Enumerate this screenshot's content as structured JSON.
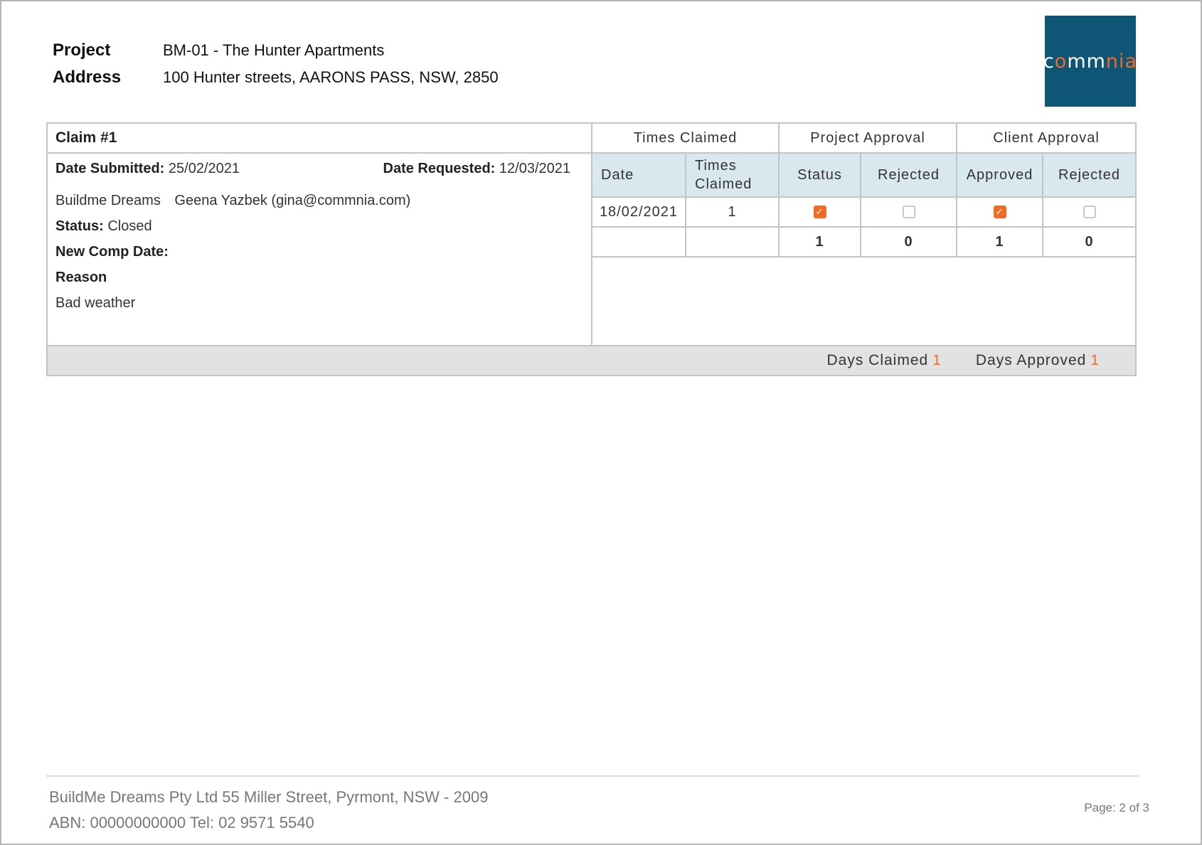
{
  "header": {
    "project_label": "Project",
    "project_value": "BM-01 -  The Hunter Apartments",
    "address_label": "Address",
    "address_value": "100 Hunter streets, AARONS PASS, NSW, 2850",
    "logo": {
      "part1": "c",
      "part2": "o",
      "part3": "mm",
      "part4": "nia",
      "bg_color": "#0f5575",
      "accent_color": "#f36a25"
    }
  },
  "claim": {
    "title": "Claim #1",
    "date_submitted_label": "Date Submitted:",
    "date_submitted": "25/02/2021",
    "date_requested_label": "Date Requested:",
    "date_requested": "12/03/2021",
    "company": "Buildme Dreams",
    "contact": "Geena Yazbek (gina@commnia.com)",
    "status_label": "Status:",
    "status_value": "Closed",
    "new_comp_date_label": "New Comp Date:",
    "reason_label": "Reason",
    "reason_value": "Bad weather"
  },
  "grid": {
    "group_headers": [
      "Times Claimed",
      "Project Approval",
      "Client Approval"
    ],
    "sub_headers": [
      "Date",
      "Times Claimed",
      "Status",
      "Rejected",
      "Approved",
      "Rejected"
    ],
    "rows": [
      {
        "date": "18/02/2021",
        "times_claimed": "1",
        "project_status": true,
        "project_rejected": false,
        "client_approved": true,
        "client_rejected": false
      }
    ],
    "totals": {
      "project_status": "1",
      "project_rejected": "0",
      "client_approved": "1",
      "client_rejected": "0"
    }
  },
  "summary": {
    "days_claimed_label": "Days Claimed",
    "days_claimed": "1",
    "days_approved_label": "Days Approved",
    "days_approved": "1"
  },
  "footer": {
    "line1": "BuildMe Dreams Pty Ltd 55 Miller Street, Pyrmont, NSW - 2009",
    "line2": "ABN: 00000000000 Tel: 02 9571 5540",
    "page": "Page: 2 of 3"
  },
  "colors": {
    "accent": "#f36a25",
    "header_bg": "#d8e8ee",
    "summary_bg": "#e2e2e2"
  }
}
